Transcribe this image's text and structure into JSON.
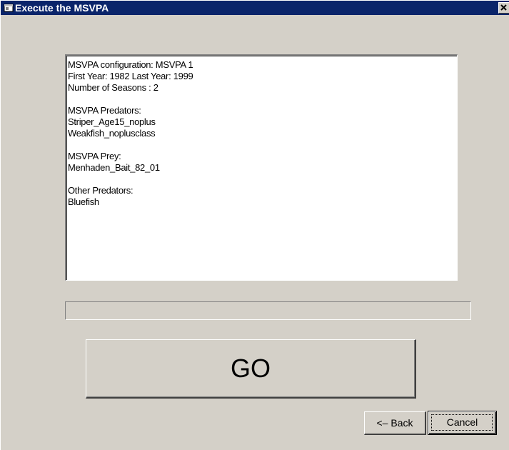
{
  "window": {
    "title": "Execute the MSVPA",
    "close_glyph": "✕",
    "icon": "app-window-icon"
  },
  "summary": {
    "lines": [
      "MSVPA configuration: MSVPA 1",
      "First Year: 1982  Last Year: 1999",
      "Number of Seasons : 2",
      "",
      "MSVPA Predators:",
      "Striper_Age15_noplus",
      "Weakfish_noplusclass",
      "",
      "MSVPA Prey:",
      "Menhaden_Bait_82_01",
      "",
      "Other Predators:",
      "Bluefish"
    ]
  },
  "progress": {
    "value": 0
  },
  "buttons": {
    "go_label": "GO",
    "back_label": "<– Back",
    "cancel_label": "Cancel"
  },
  "colors": {
    "face": "#d4d0c8",
    "titlebar": "#0a246a",
    "textbox": "#ffffff"
  }
}
